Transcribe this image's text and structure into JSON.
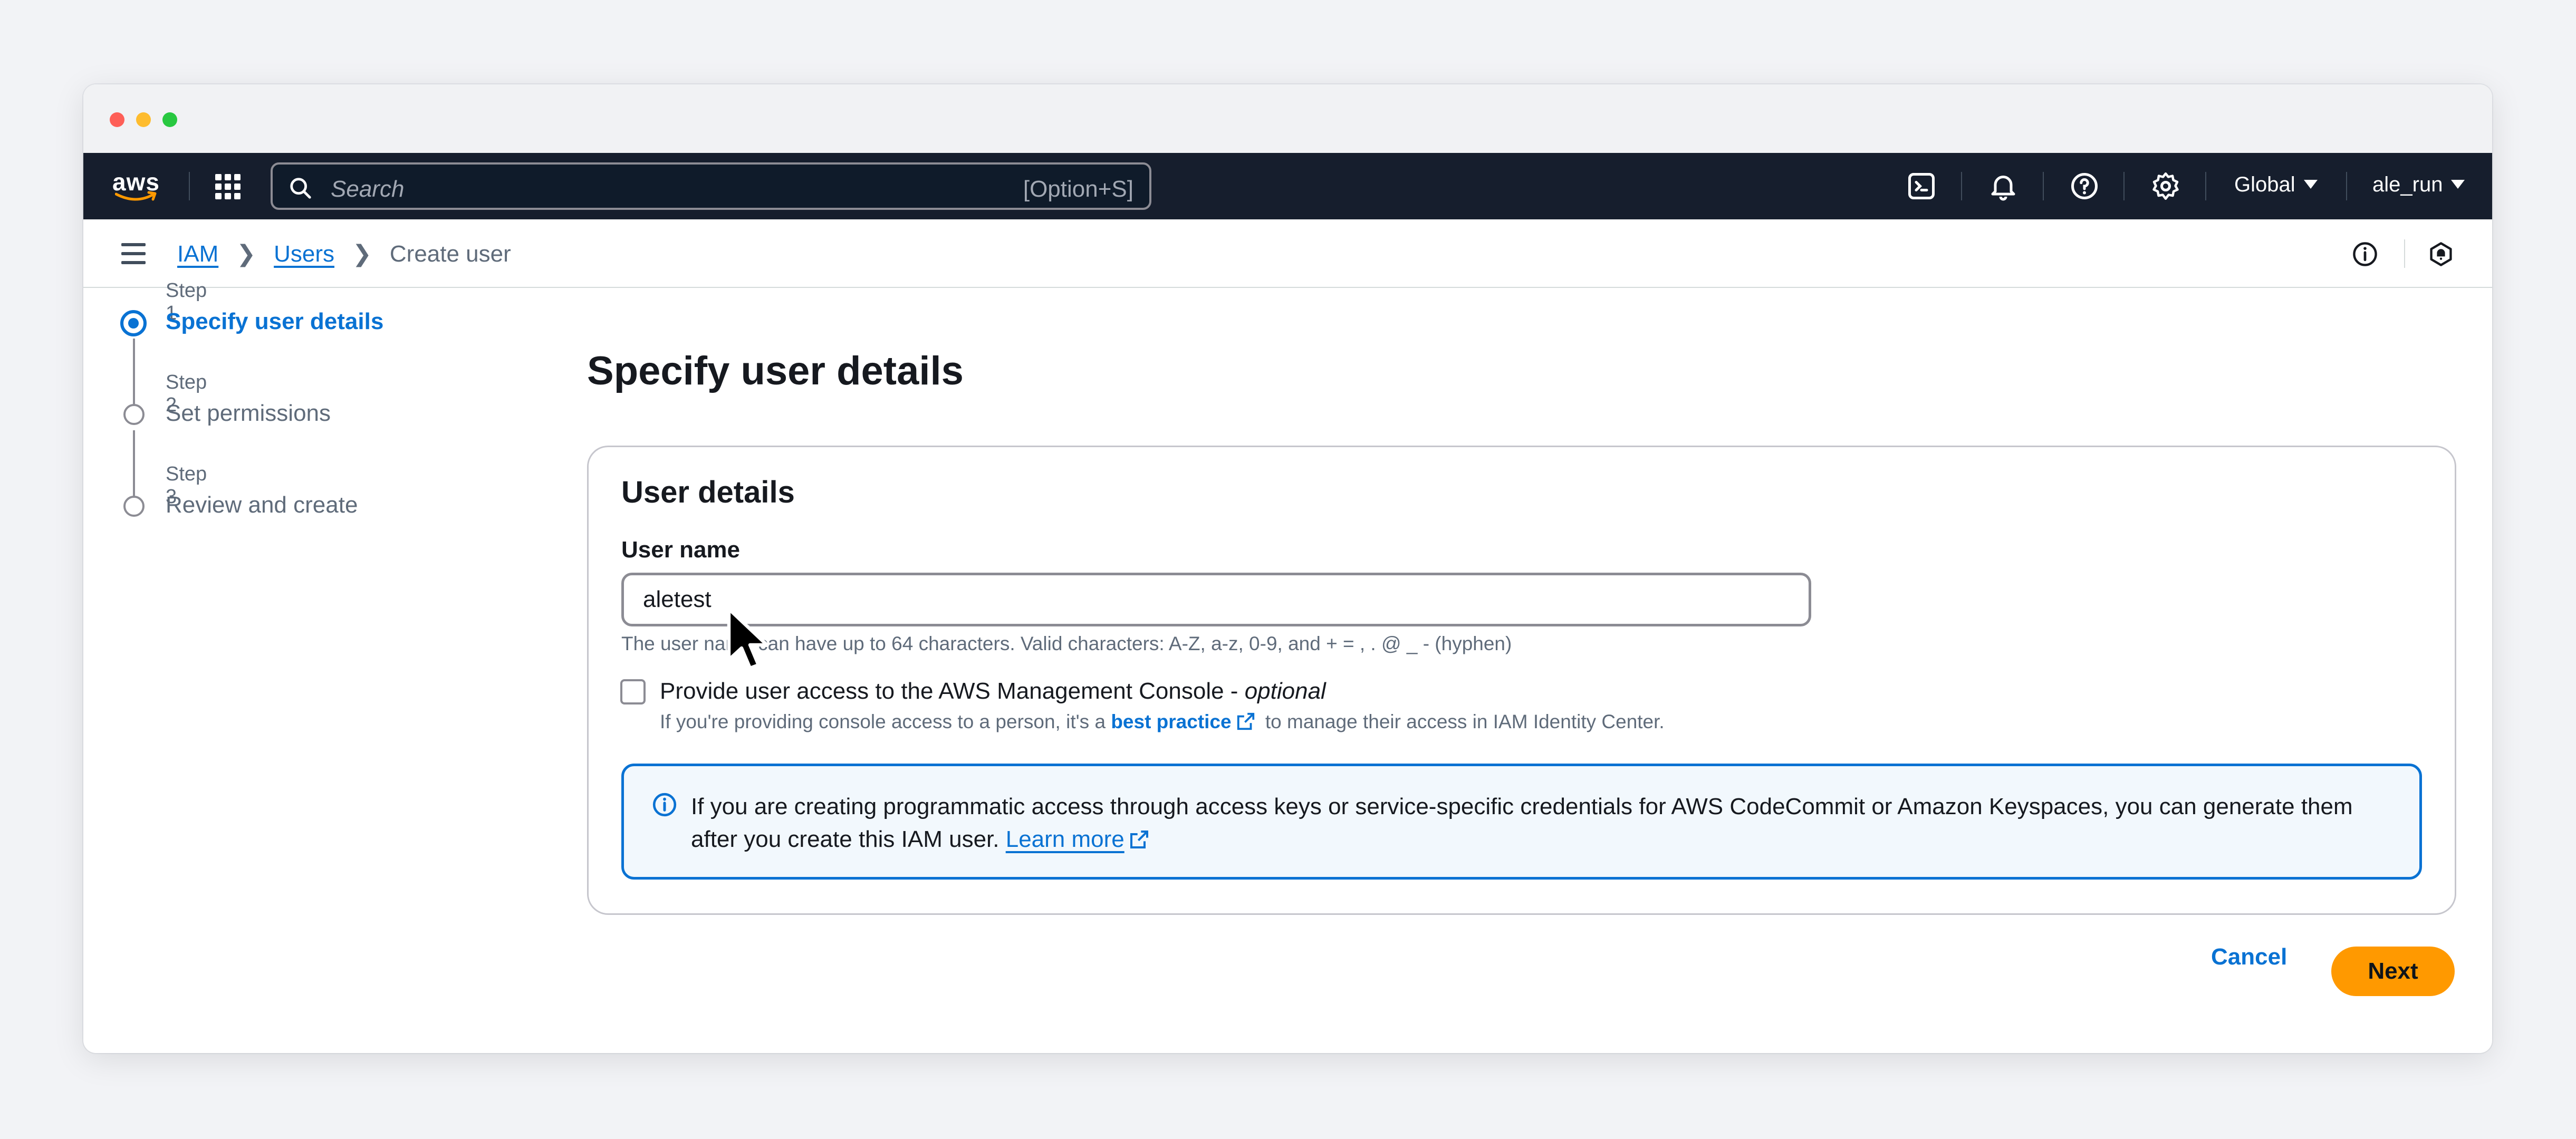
{
  "topnav": {
    "logo": "aws",
    "search_placeholder": "Search",
    "search_shortcut": "[Option+S]",
    "region": "Global",
    "account": "ale_run",
    "icons": [
      "cloudshell-icon",
      "bell-icon",
      "help-icon",
      "gear-icon"
    ]
  },
  "breadcrumb": {
    "items": [
      "IAM",
      "Users"
    ],
    "current": "Create user"
  },
  "steps": [
    {
      "label": "Step 1",
      "title": "Specify user details"
    },
    {
      "label": "Step 2",
      "title": "Set permissions"
    },
    {
      "label": "Step 3",
      "title": "Review and create"
    }
  ],
  "page_title": "Specify user details",
  "panel": {
    "title": "User details",
    "username_label": "User name",
    "username_value": "aletest",
    "username_hint": "The user name can have up to 64 characters. Valid characters: A-Z, a-z, 0-9, and + = , . @ _ - (hyphen)",
    "console_label": "Provide user access to the AWS Management Console - ",
    "console_optional": "optional",
    "console_desc_before": "If you're providing console access to a person, it's a ",
    "console_desc_link": "best practice",
    "console_desc_after": " to manage their access in IAM Identity Center.",
    "info_text": "If you are creating programmatic access through access keys or service-specific credentials for AWS CodeCommit or Amazon Keyspaces, you can generate them after you create this IAM user. ",
    "info_link": "Learn more"
  },
  "actions": {
    "cancel": "Cancel",
    "next": "Next"
  },
  "colors": {
    "accent": "#0972d3",
    "primary_button": "#ff9900",
    "nav_bg": "#161e2d"
  }
}
